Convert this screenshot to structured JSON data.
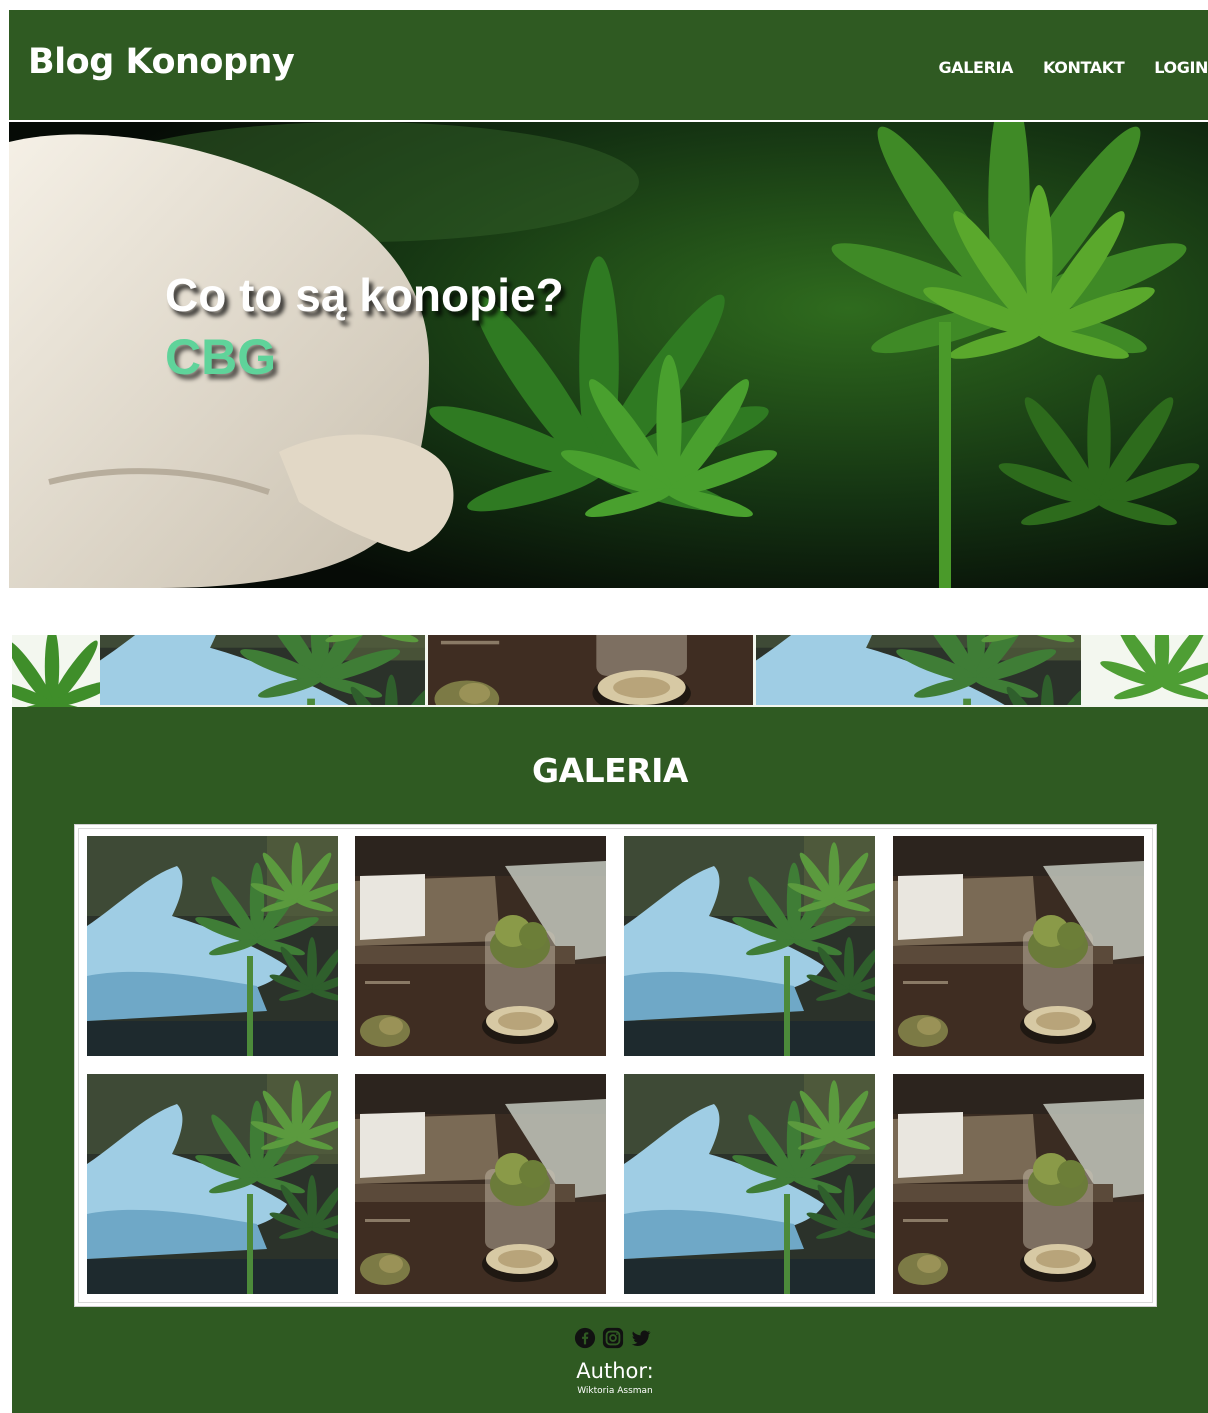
{
  "header": {
    "brand": "Blog Konopny",
    "nav": [
      "GALERIA",
      "KONTAKT",
      "LOGIN"
    ]
  },
  "hero": {
    "title": "Co to są konopie?",
    "subtitle": "CBG"
  },
  "gallery": {
    "title": "GALERIA",
    "tiles": [
      "hand-plant",
      "jar-desk",
      "hand-plant",
      "jar-desk",
      "hand-plant",
      "jar-desk",
      "hand-plant",
      "jar-desk"
    ]
  },
  "footer": {
    "social_icons": [
      "facebook-icon",
      "instagram-icon",
      "twitter-icon"
    ],
    "author_label": "Author:",
    "author_name": "Wiktoria Assman"
  },
  "colors": {
    "header_bg": "#2f5a22",
    "section_bg": "#2f5a22",
    "accent_green": "#5fd39a",
    "text": "#ffffff"
  }
}
